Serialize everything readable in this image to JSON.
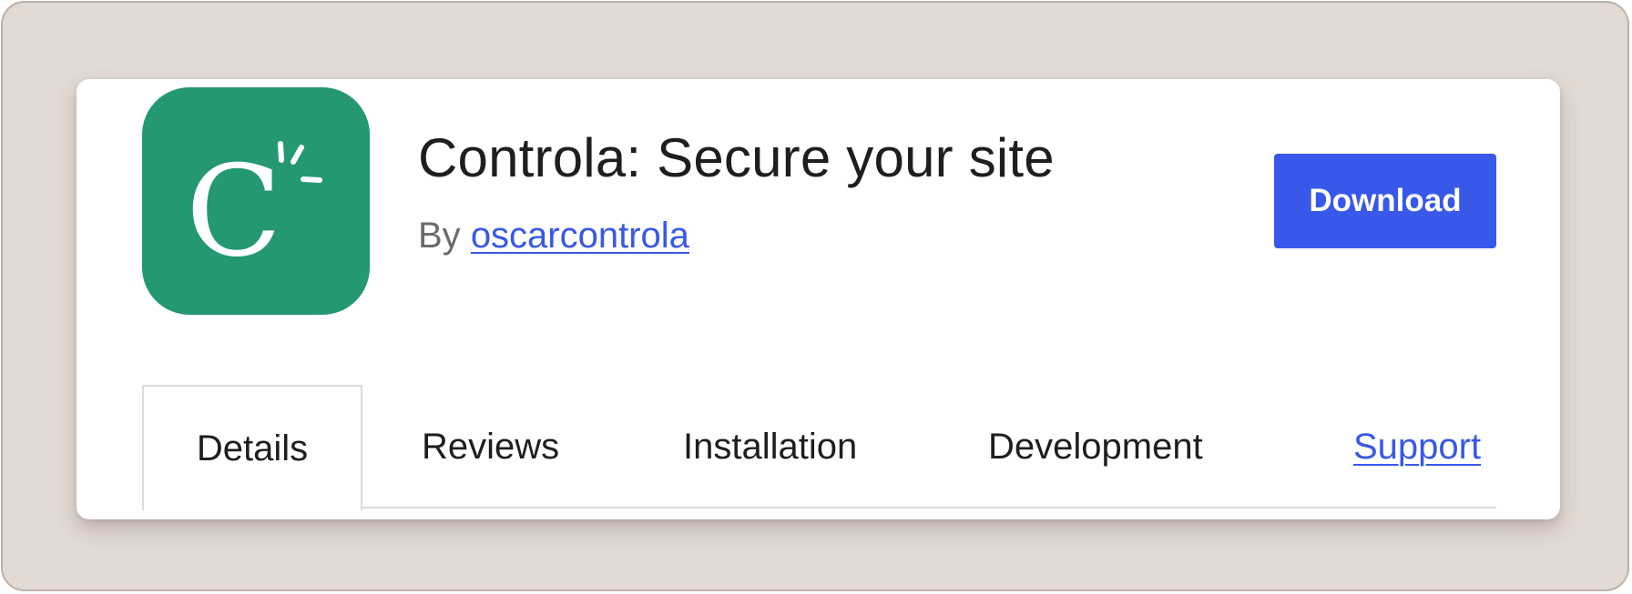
{
  "plugin": {
    "icon": "controla-logo-icon",
    "icon_letter": "C",
    "title": "Controla: Secure your site",
    "by_prefix": "By",
    "author": "oscarcontrola"
  },
  "actions": {
    "download_label": "Download"
  },
  "tabs": [
    {
      "label": "Details",
      "active": true
    },
    {
      "label": "Reviews",
      "active": false
    },
    {
      "label": "Installation",
      "active": false
    },
    {
      "label": "Development",
      "active": false
    },
    {
      "label": "Support",
      "active": false,
      "link": true
    }
  ],
  "colors": {
    "background": "#e3dad4",
    "icon_green": "#239872",
    "accent_blue": "#3858e9",
    "text_dark": "#1e1e1e",
    "text_muted": "#6b6b6b",
    "tab_border": "#dcdcde"
  }
}
